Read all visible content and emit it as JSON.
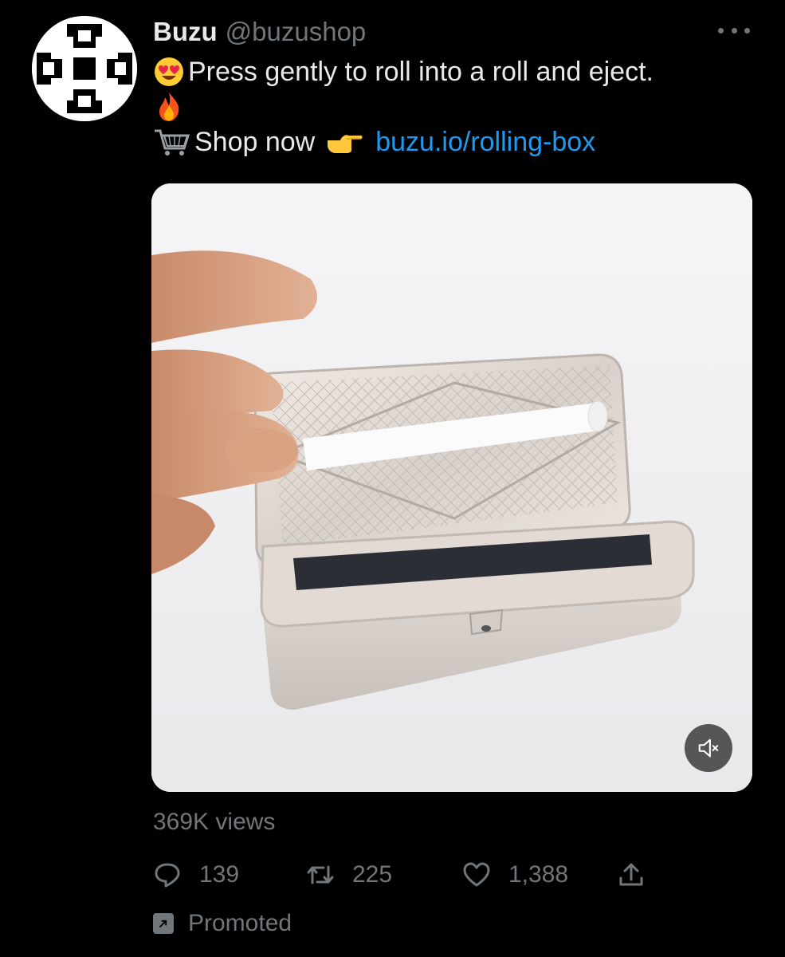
{
  "tweet": {
    "author_name": "Buzu",
    "author_handle": "@buzushop",
    "line1": "Press gently to roll into a roll and eject.",
    "line3_prefix": "Shop now",
    "link": "buzu.io/rolling-box",
    "line1_emoji": "heart-eyes-emoji",
    "line2_emoji": "fire-emoji",
    "line3_emoji": "shopping-cart-emoji",
    "pointer_emoji": "pointing-right-emoji"
  },
  "media": {
    "type": "video",
    "subject": "silver rolling box",
    "muted": true
  },
  "stats": {
    "views": "369K views",
    "replies": "139",
    "retweets": "225",
    "likes": "1,388"
  },
  "footer": {
    "promoted_label": "Promoted"
  },
  "colors": {
    "background": "#000000",
    "text": "#e7e9ea",
    "secondary": "#71767b",
    "link": "#1d9bf0"
  }
}
